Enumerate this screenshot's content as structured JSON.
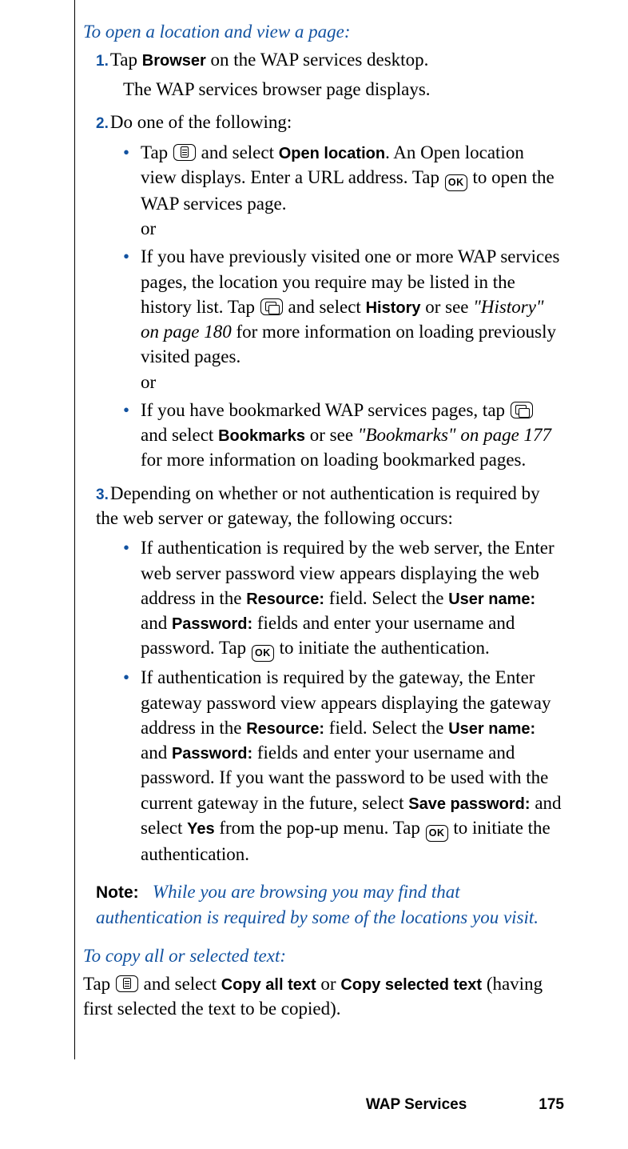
{
  "section1": {
    "title": "To open a location and view a page:",
    "steps": [
      {
        "num": "1.",
        "text_before_bold": "Tap ",
        "bold": "Browser",
        "text_after_bold": " on the WAP services desktop.",
        "followup": "The WAP services browser page displays."
      },
      {
        "num": "2.",
        "text": "Do one of the following:",
        "bullets": [
          {
            "pre_icon": "Tap ",
            "icon1": "list",
            "mid1": " and select ",
            "bold1": "Open location",
            "mid2": ". An Open location view displays. Enter a URL address. Tap ",
            "icon2": "ok",
            "post": " to open the WAP services page.",
            "or": "or"
          },
          {
            "pre": "If you have previously visited one or more WAP services pages, the location you require may be listed in the history list. Tap ",
            "icon1": "window",
            "mid1": " and select ",
            "bold1": "History",
            "mid2": " or see ",
            "italic_ref": "\"History\" on page 180",
            "post": " for more information on loading previously visited pages.",
            "or": "or"
          },
          {
            "pre": "If you have bookmarked WAP services pages, tap ",
            "icon1": "window",
            "mid1": " and select ",
            "bold1": "Bookmarks",
            "mid2": " or see ",
            "italic_ref": "\"Bookmarks\" on page 177",
            "post": " for more information on loading bookmarked pages."
          }
        ]
      },
      {
        "num": "3.",
        "text": "Depending on whether or not authentication is required by the web server or gateway, the following occurs:",
        "bullets3": [
          {
            "pre": "If authentication is required by the web server, the Enter web server password view appears displaying the web address in the ",
            "b1": "Resource:",
            "m1": " field. Select the ",
            "b2": "User name:",
            "m2": " and ",
            "b3": "Password:",
            "m3": " fields and enter your username and password. Tap ",
            "icon": "ok",
            "post": " to initiate the authentication."
          },
          {
            "pre": "If authentication is required by the gateway, the Enter gateway password view appears displaying the gateway address in the ",
            "b1": "Resource:",
            "m1": " field. Select the ",
            "b2": "User name:",
            "m2": " and ",
            "b3": "Password:",
            "m3": " fields and enter your username and password. If you want the password to be used with the current gateway in the future, select ",
            "b4": "Save password:",
            "m4": " and select ",
            "b5": "Yes",
            "m5": " from the pop-up menu. Tap ",
            "icon": "ok",
            "post": " to initiate the authentication."
          }
        ]
      }
    ],
    "note": {
      "label": "Note:",
      "body": "While you are browsing you may find that authentication is required by some of the locations you visit."
    }
  },
  "section2": {
    "title": "To copy all or selected text:",
    "para": {
      "pre": "Tap ",
      "icon": "list",
      "m1": " and select ",
      "b1": "Copy all text",
      "m2": " or ",
      "b2": "Copy selected text",
      "post": " (having first selected the text to be copied)."
    }
  },
  "footer": {
    "chapter": "WAP Services",
    "page": "175"
  }
}
